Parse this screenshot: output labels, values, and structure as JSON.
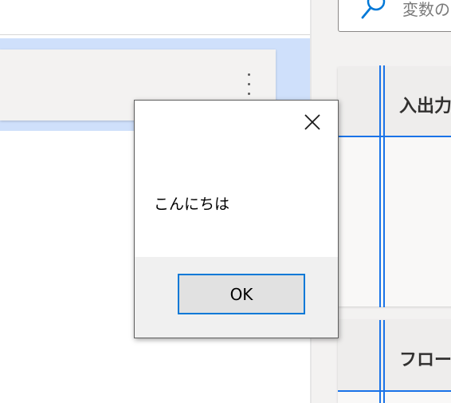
{
  "search": {
    "placeholder": "変数の"
  },
  "variables_pane": {
    "io_section_title": "入出力",
    "flow_section_title": "フロー変"
  },
  "dialog": {
    "message": "こんにちは",
    "ok_label": "OK"
  },
  "icons": {
    "search": "search-icon",
    "close": "close-icon",
    "more": "more-options-icon"
  },
  "colors": {
    "accent": "#0078d7",
    "selection": "#cfe0fb",
    "pane_background": "#f3f2f1"
  }
}
